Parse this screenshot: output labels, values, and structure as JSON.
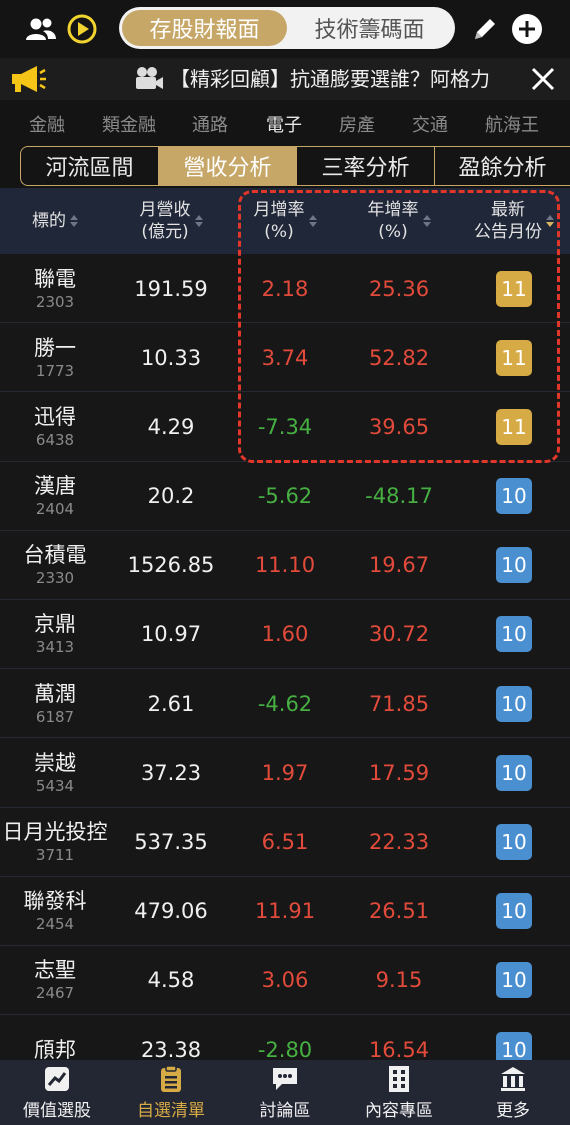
{
  "header": {
    "tabs": [
      {
        "label": "存股財報面",
        "active": true
      },
      {
        "label": "技術籌碼面",
        "active": false
      }
    ]
  },
  "marquee": {
    "text": "【精彩回顧】抗通膨要選誰？阿格力"
  },
  "categories": [
    {
      "label": "金融",
      "active": false
    },
    {
      "label": "類金融",
      "active": false
    },
    {
      "label": "通路",
      "active": false
    },
    {
      "label": "電子",
      "active": true
    },
    {
      "label": "房產",
      "active": false
    },
    {
      "label": "交通",
      "active": false
    },
    {
      "label": "航海王",
      "active": false
    }
  ],
  "analysis_tabs": [
    {
      "label": "河流區間",
      "active": false
    },
    {
      "label": "營收分析",
      "active": true
    },
    {
      "label": "三率分析",
      "active": false
    },
    {
      "label": "盈餘分析",
      "active": false
    }
  ],
  "table": {
    "headers": {
      "name": "標的",
      "revenue_1": "月營收",
      "revenue_2": "(億元)",
      "mom_1": "月增率",
      "mom_2": "(%)",
      "yoy_1": "年增率",
      "yoy_2": "(%)",
      "month_1": "最新",
      "month_2": "公告月份"
    },
    "rows": [
      {
        "name": "聯電",
        "code": "2303",
        "revenue": "191.59",
        "mom": "2.18",
        "yoy": "25.36",
        "month": "11"
      },
      {
        "name": "勝一",
        "code": "1773",
        "revenue": "10.33",
        "mom": "3.74",
        "yoy": "52.82",
        "month": "11"
      },
      {
        "name": "迅得",
        "code": "6438",
        "revenue": "4.29",
        "mom": "-7.34",
        "yoy": "39.65",
        "month": "11"
      },
      {
        "name": "漢唐",
        "code": "2404",
        "revenue": "20.2",
        "mom": "-5.62",
        "yoy": "-48.17",
        "month": "10"
      },
      {
        "name": "台積電",
        "code": "2330",
        "revenue": "1526.85",
        "mom": "11.10",
        "yoy": "19.67",
        "month": "10"
      },
      {
        "name": "京鼎",
        "code": "3413",
        "revenue": "10.97",
        "mom": "1.60",
        "yoy": "30.72",
        "month": "10"
      },
      {
        "name": "萬潤",
        "code": "6187",
        "revenue": "2.61",
        "mom": "-4.62",
        "yoy": "71.85",
        "month": "10"
      },
      {
        "name": "崇越",
        "code": "5434",
        "revenue": "37.23",
        "mom": "1.97",
        "yoy": "17.59",
        "month": "10"
      },
      {
        "name": "日月光投控",
        "code": "3711",
        "revenue": "537.35",
        "mom": "6.51",
        "yoy": "22.33",
        "month": "10"
      },
      {
        "name": "聯發科",
        "code": "2454",
        "revenue": "479.06",
        "mom": "11.91",
        "yoy": "26.51",
        "month": "10"
      },
      {
        "name": "志聖",
        "code": "2467",
        "revenue": "4.58",
        "mom": "3.06",
        "yoy": "9.15",
        "month": "10"
      },
      {
        "name": "頎邦",
        "code": "",
        "revenue": "23.38",
        "mom": "-2.80",
        "yoy": "16.54",
        "month": "10"
      }
    ]
  },
  "bottom_nav": [
    {
      "label": "價值選股",
      "icon": "chart-icon",
      "active": false
    },
    {
      "label": "自選清單",
      "icon": "clipboard-icon",
      "active": true
    },
    {
      "label": "討論區",
      "icon": "chat-icon",
      "active": false
    },
    {
      "label": "內容專區",
      "icon": "building-icon",
      "active": false
    },
    {
      "label": "更多",
      "icon": "bank-icon",
      "active": false
    }
  ],
  "colors": {
    "accent": "#c6a768",
    "positive": "#e24b3b",
    "negative": "#46b043",
    "badge_current": "#d6aa44",
    "badge_prev": "#4a8fd0",
    "highlight": "#e2362a"
  }
}
